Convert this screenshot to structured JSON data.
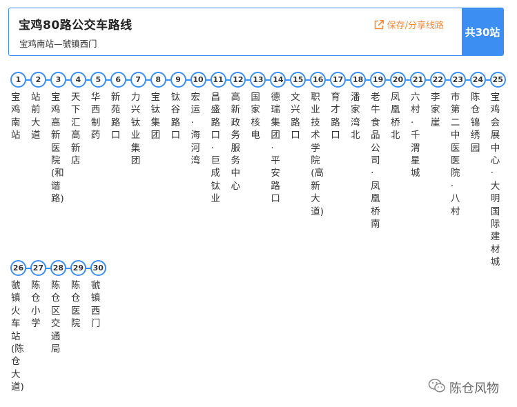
{
  "header": {
    "title": "宝鸡80路公交车路线",
    "route": "宝鸡南站—虢镇西门",
    "save_label": "保存/分享线路",
    "save_icon": "share-icon",
    "stop_count": "共30站",
    "accent_color": "#3d8ef2",
    "link_color": "#f08a3e"
  },
  "stops": [
    {
      "num": "1",
      "name": "宝鸡南站"
    },
    {
      "num": "2",
      "name": "站前大道"
    },
    {
      "num": "3",
      "name": "宝鸡高新医院(和谐路)"
    },
    {
      "num": "4",
      "name": "天下汇高新店"
    },
    {
      "num": "5",
      "name": "华西制药"
    },
    {
      "num": "6",
      "name": "新苑路口"
    },
    {
      "num": "7",
      "name": "力兴钛业集团"
    },
    {
      "num": "8",
      "name": "宝钛集团"
    },
    {
      "num": "9",
      "name": "钛谷路口"
    },
    {
      "num": "10",
      "name": "宏运·海河湾"
    },
    {
      "num": "11",
      "name": "昌盛路口·巨成钛业"
    },
    {
      "num": "12",
      "name": "高新政务服务中心"
    },
    {
      "num": "13",
      "name": "国家核电"
    },
    {
      "num": "14",
      "name": "德瑞集团·平安路口"
    },
    {
      "num": "15",
      "name": "文兴路口"
    },
    {
      "num": "16",
      "name": "职业技术学院(高新大道)"
    },
    {
      "num": "17",
      "name": "育才路口"
    },
    {
      "num": "18",
      "name": "潘家湾北"
    },
    {
      "num": "19",
      "name": "老牛食品公司·凤凰桥南"
    },
    {
      "num": "20",
      "name": "凤凰桥北"
    },
    {
      "num": "21",
      "name": "六村·千渭星城"
    },
    {
      "num": "22",
      "name": "李家崖"
    },
    {
      "num": "23",
      "name": "市第二中医医院·八村"
    },
    {
      "num": "24",
      "name": "陈仓锦绣园"
    },
    {
      "num": "25",
      "name": "宝鸡会展中心·大明国际建材城"
    },
    {
      "num": "26",
      "name": "虢镇火车站(陈仓大道)"
    },
    {
      "num": "27",
      "name": "陈仓小学"
    },
    {
      "num": "28",
      "name": "陈仓区交通局"
    },
    {
      "num": "29",
      "name": "陈仓医院"
    },
    {
      "num": "30",
      "name": "虢镇西门"
    }
  ],
  "watermark": {
    "text": "陈仓风物",
    "icon": "wechat-icon"
  }
}
